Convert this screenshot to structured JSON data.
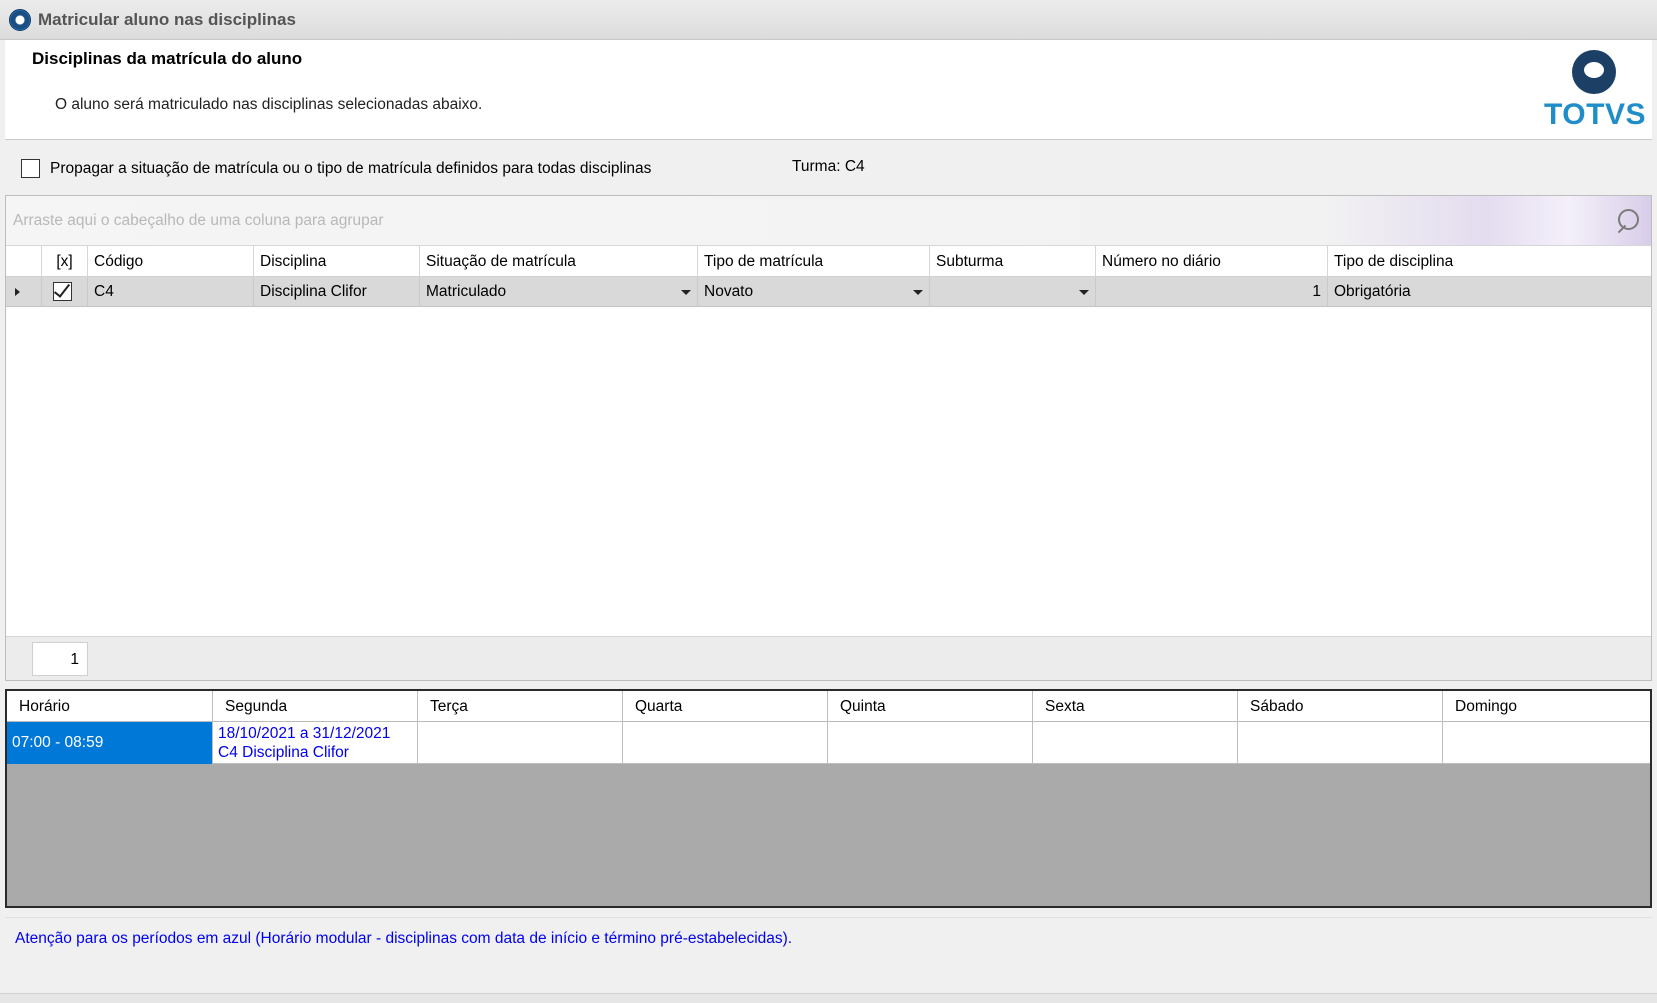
{
  "window": {
    "title": "Matricular aluno nas disciplinas",
    "icon": "app-circle-icon"
  },
  "header": {
    "title": "Disciplinas da matrícula do aluno",
    "subtitle": "O aluno será matriculado nas disciplinas selecionadas abaixo.",
    "logo_text": "TOTVS"
  },
  "options": {
    "propagate_label": "Propagar a situação de matrícula ou o tipo de matrícula definidos para todas disciplinas",
    "propagate_checked": false,
    "turma_label": "Turma: C4"
  },
  "grid": {
    "group_placeholder": "Arraste aqui o cabeçalho de uma coluna para agrupar",
    "columns": [
      "[x]",
      "Código",
      "Disciplina",
      "Situação de matrícula",
      "Tipo de matrícula",
      "Subturma",
      "Número no diário",
      "Tipo de disciplina"
    ],
    "rows": [
      {
        "checked": true,
        "codigo": "C4",
        "disciplina": "Disciplina Clifor",
        "situacao": "Matriculado",
        "tipo_matricula": "Novato",
        "subturma": "",
        "numero_diario": "1",
        "tipo_disciplina": "Obrigatória"
      }
    ],
    "page": "1"
  },
  "schedule": {
    "columns": [
      "Horário",
      "Segunda",
      "Terça",
      "Quarta",
      "Quinta",
      "Sexta",
      "Sábado",
      "Domingo"
    ],
    "rows": [
      {
        "horario": "07:00 - 08:59",
        "segunda_line1": "18/10/2021 a 31/12/2021",
        "segunda_line2": "C4  Disciplina Clifor"
      }
    ]
  },
  "footer": {
    "note": "Atenção para os períodos em azul (Horário modular - disciplinas com data de início e término pré-estabelecidas)."
  },
  "colors": {
    "selection": "#0078d7",
    "modular_text": "#0000ee",
    "logo": "#1f8dc8"
  }
}
